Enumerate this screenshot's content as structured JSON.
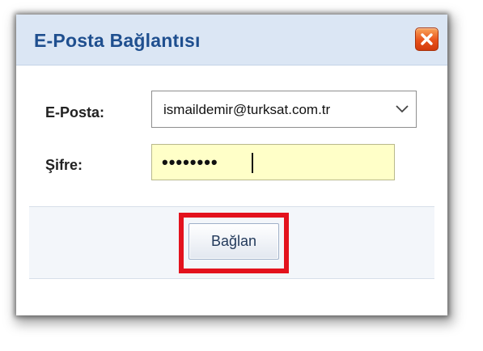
{
  "dialog": {
    "title": "E-Posta Bağlantısı",
    "close_icon": "close-icon"
  },
  "form": {
    "email_label": "E-Posta:",
    "email_value": "ismaildemir@turksat.com.tr",
    "email_dropdown_icon": "chevron-down-icon",
    "password_label": "Şifre:",
    "password_value": "••••••••",
    "password_field_color": "#ffffc8"
  },
  "footer": {
    "connect_label": "Bağlan",
    "highlight_color": "#e3121d"
  }
}
